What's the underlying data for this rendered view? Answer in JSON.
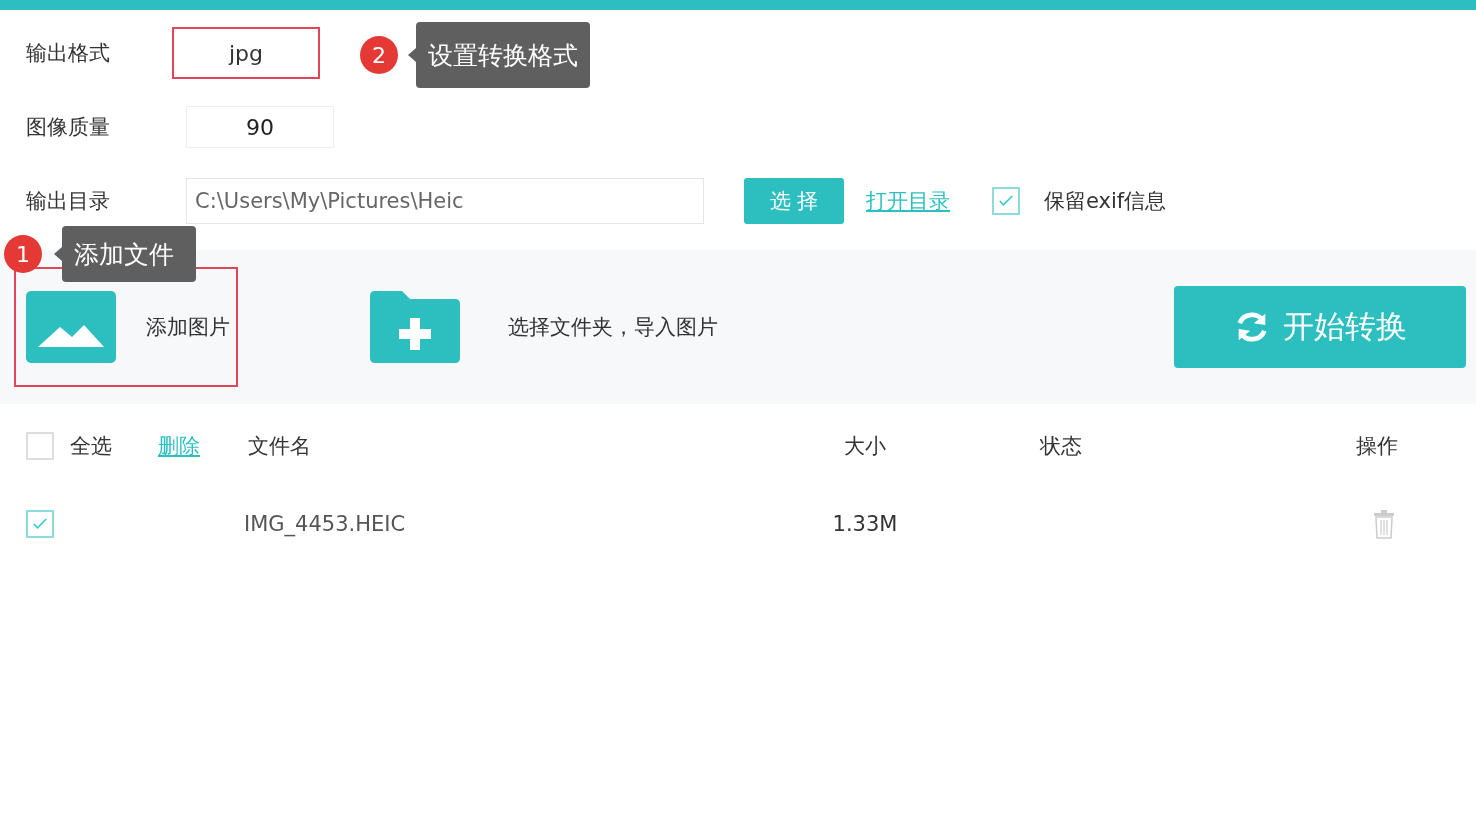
{
  "settings": {
    "format": {
      "label": "输出格式",
      "value": "jpg",
      "highlighted": true
    },
    "quality": {
      "label": "图像质量",
      "value": "90"
    },
    "directory": {
      "label": "输出目录",
      "value": "C:\\Users\\My\\Pictures\\Heic",
      "choose_button": "选 择",
      "open_link": "打开目录",
      "keep_exif": {
        "label": "保留exif信息",
        "checked": true
      }
    }
  },
  "toolbar": {
    "add_image": {
      "label": "添加图片",
      "highlighted": true
    },
    "add_folder": {
      "label": "选择文件夹，导入图片"
    },
    "start_button": "开始转换"
  },
  "table": {
    "select_all": {
      "label": "全选",
      "checked": false
    },
    "delete_link": "删除",
    "columns": [
      "文件名",
      "大小",
      "状态",
      "操作"
    ],
    "rows": [
      {
        "checked": true,
        "name": "IMG_4453.HEIC",
        "size": "1.33M"
      }
    ]
  },
  "callouts": [
    {
      "number": "2",
      "text": "设置转换格式"
    },
    {
      "number": "1",
      "text": "添加文件"
    }
  ]
}
